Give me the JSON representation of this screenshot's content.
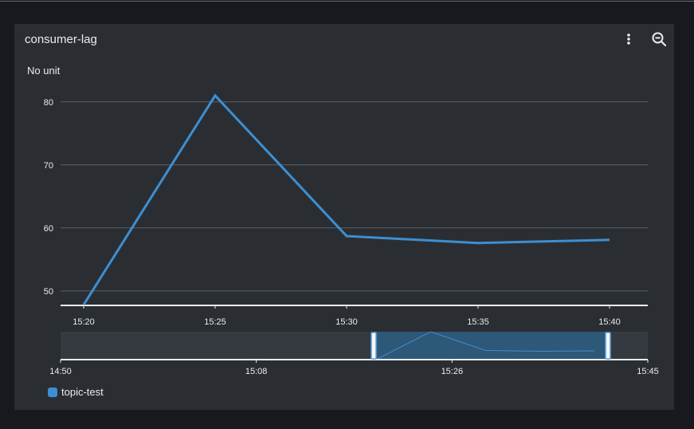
{
  "widget": {
    "title": "consumer-lag",
    "menu_icon": "kebab-menu-icon",
    "zoom_icon": "zoom-out-icon"
  },
  "chart_data": {
    "type": "line",
    "ylabel": "No unit",
    "ylim": [
      47.7,
      82.5
    ],
    "yticks": [
      50,
      60,
      70,
      80
    ],
    "xticks": [
      "15:20",
      "15:25",
      "15:30",
      "15:35",
      "15:40"
    ],
    "grid": true,
    "series": [
      {
        "name": "topic-test",
        "color": "#3d8fd1",
        "x": [
          "15:20",
          "15:25",
          "15:30",
          "15:35",
          "15:40"
        ],
        "values": [
          47.8,
          81.0,
          58.7,
          57.6,
          58.1
        ]
      }
    ],
    "navigator": {
      "ticks": [
        "14:50",
        "15:08",
        "15:26",
        "15:45"
      ],
      "selection": [
        "15:20",
        "15:44"
      ]
    },
    "legend": {
      "position": "bottom-left",
      "labels": [
        "topic-test"
      ]
    }
  }
}
